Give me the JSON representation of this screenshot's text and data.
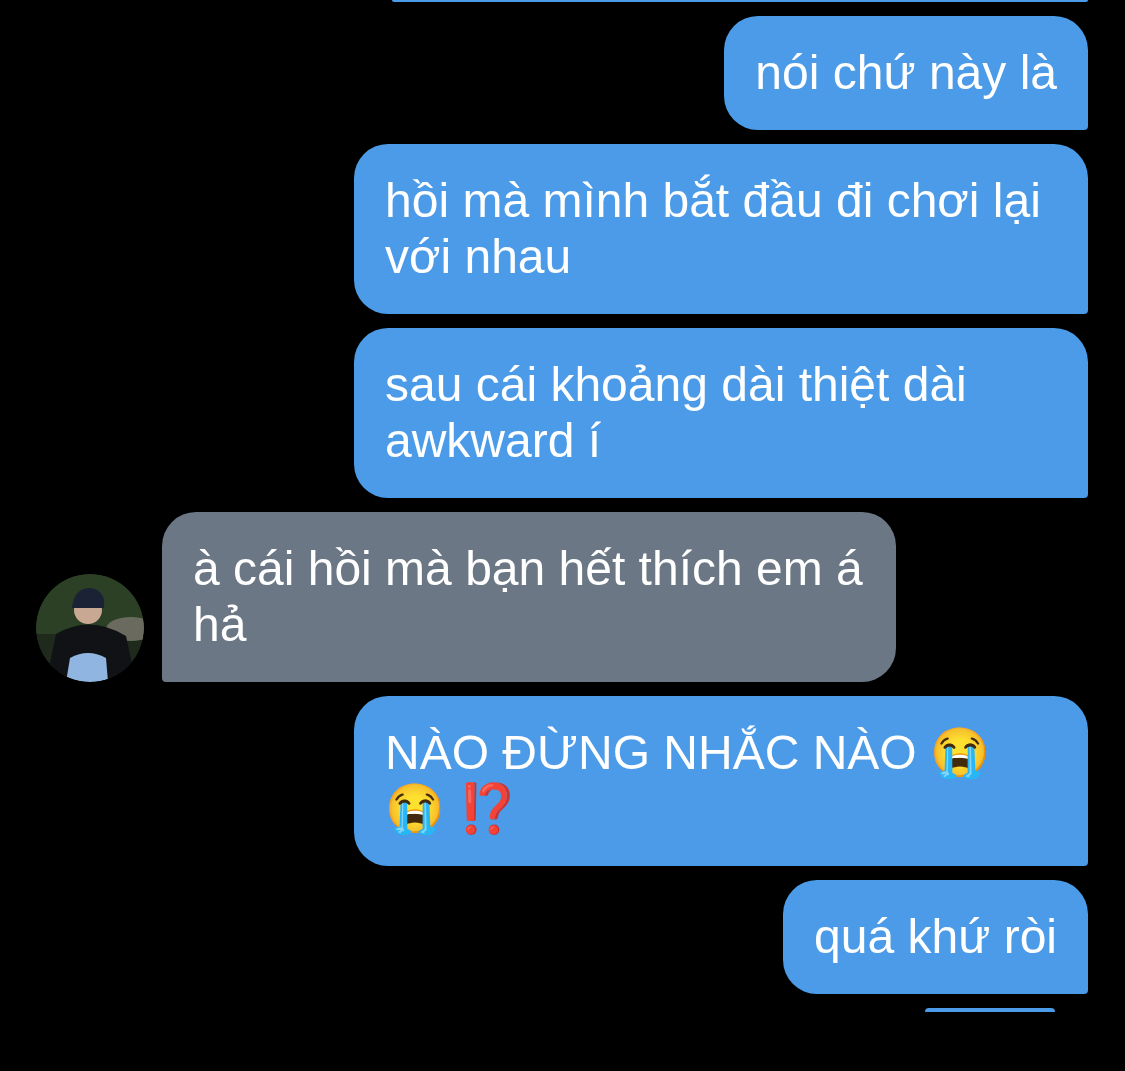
{
  "messages": [
    {
      "outgoing": true,
      "kind": "clipped"
    },
    {
      "outgoing": true,
      "kind": "text",
      "text": "nói chứ này là"
    },
    {
      "outgoing": true,
      "kind": "text",
      "text": "hồi mà mình bắt đầu đi chơi lại với nhau"
    },
    {
      "outgoing": true,
      "kind": "text",
      "text": "sau cái khoảng dài thiệt dài awkward í"
    },
    {
      "outgoing": false,
      "kind": "text",
      "text": "à cái hồi mà bạn hết thích em á hả"
    },
    {
      "outgoing": true,
      "kind": "text",
      "text": "NÀO ĐỪNG NHẮC NÀO 😭 😭 ⁉️"
    },
    {
      "outgoing": true,
      "kind": "text",
      "text": "quá khứ ròi"
    },
    {
      "outgoing": true,
      "kind": "clipped"
    }
  ]
}
